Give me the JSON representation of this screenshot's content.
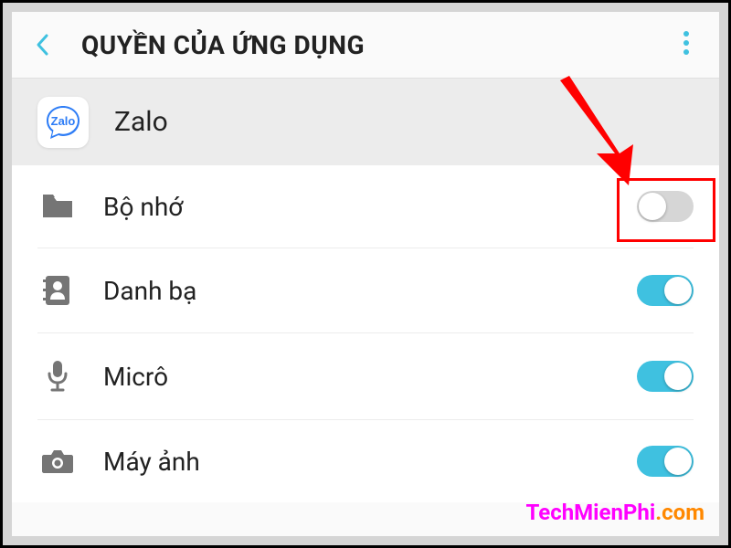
{
  "header": {
    "title": "QUYỀN CỦA ỨNG DỤNG"
  },
  "app": {
    "name": "Zalo",
    "icon_label": "Zalo"
  },
  "permissions": [
    {
      "key": "storage",
      "label": "Bộ nhớ",
      "enabled": false,
      "icon": "folder"
    },
    {
      "key": "contacts",
      "label": "Danh bạ",
      "enabled": true,
      "icon": "contacts"
    },
    {
      "key": "microphone",
      "label": "Micrô",
      "enabled": true,
      "icon": "mic"
    },
    {
      "key": "camera",
      "label": "Máy ảnh",
      "enabled": true,
      "icon": "camera"
    }
  ],
  "annotations": {
    "highlighted_toggle": "storage",
    "arrow_color": "#ff0000"
  },
  "watermark": {
    "text1": "TechMienPhi",
    "text2": ".com"
  }
}
